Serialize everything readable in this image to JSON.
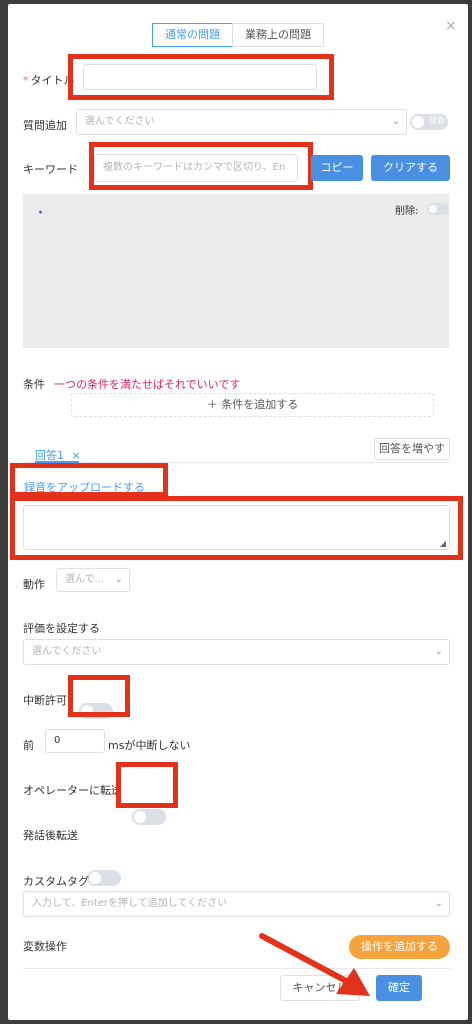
{
  "tabs": [
    "通常の問題",
    "業務上の問題"
  ],
  "close_icon": "×",
  "title_field": {
    "label": "タイトル",
    "required_mark": "*",
    "value": ""
  },
  "question_add": {
    "label": "質問追加",
    "placeholder": "選んでください",
    "toggle_label": "検索"
  },
  "keyword": {
    "label": "キーワード",
    "placeholder": "複数のキーワードはカンマで区切り、En",
    "copy_button": "コピー",
    "clear_button": "クリアする"
  },
  "keyword_box": {
    "dot": "・",
    "delete_label": "削除:"
  },
  "condition": {
    "label": "条件",
    "hint": "一つの条件を満たせばそれでいいです",
    "add_button": "＋ 条件を追加する"
  },
  "answer": {
    "tab_label": "回答1",
    "tab_close": "×",
    "add_button": "回答を増やす"
  },
  "upload": {
    "label": "録音をアップロードする"
  },
  "action": {
    "label": "動作",
    "placeholder": "選んで..."
  },
  "evaluation": {
    "label": "評価を設定する",
    "placeholder": "選んでください"
  },
  "interrupt": {
    "label": "中断許可",
    "on": false
  },
  "pre": {
    "label": "前",
    "value": "0",
    "suffix": "msが中断しない"
  },
  "transfer_operator": {
    "label": "オペレーターに転送",
    "on": false
  },
  "after_transfer": {
    "label": "発話後転送",
    "on": false
  },
  "custom_tag": {
    "label": "カスタムタグ",
    "placeholder": "入力して、Enterを押して追加してください"
  },
  "variable": {
    "label": "変数操作",
    "add_button": "操作を追加する"
  },
  "footer": {
    "cancel": "キャンセル",
    "confirm": "確定"
  },
  "colors": {
    "accent": "#409eff",
    "highlight": "#e2321c",
    "orange": "#f4a33d",
    "required": "#f56c6c"
  }
}
